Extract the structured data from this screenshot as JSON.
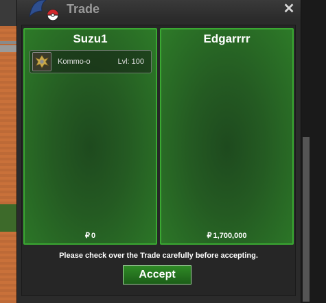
{
  "window": {
    "title": "Trade",
    "close_glyph": "✕"
  },
  "left_panel": {
    "player_name": "Suzu1",
    "money_symbol": "₽",
    "money": "0",
    "items": [
      {
        "name": "Kommo-o",
        "level": "Lvl: 100",
        "icon": "kommo-o-sprite-icon"
      }
    ]
  },
  "right_panel": {
    "player_name": "Edgarrrr",
    "money_symbol": "₽",
    "money": "1,700,000",
    "items": []
  },
  "notice": "Please check over the Trade carefully before accepting.",
  "accept_label": "Accept",
  "colors": {
    "panel_border": "#3aa832",
    "panel_fill": "#245a22",
    "button": "#2f8a26",
    "title_text": "#9a9a9a"
  }
}
